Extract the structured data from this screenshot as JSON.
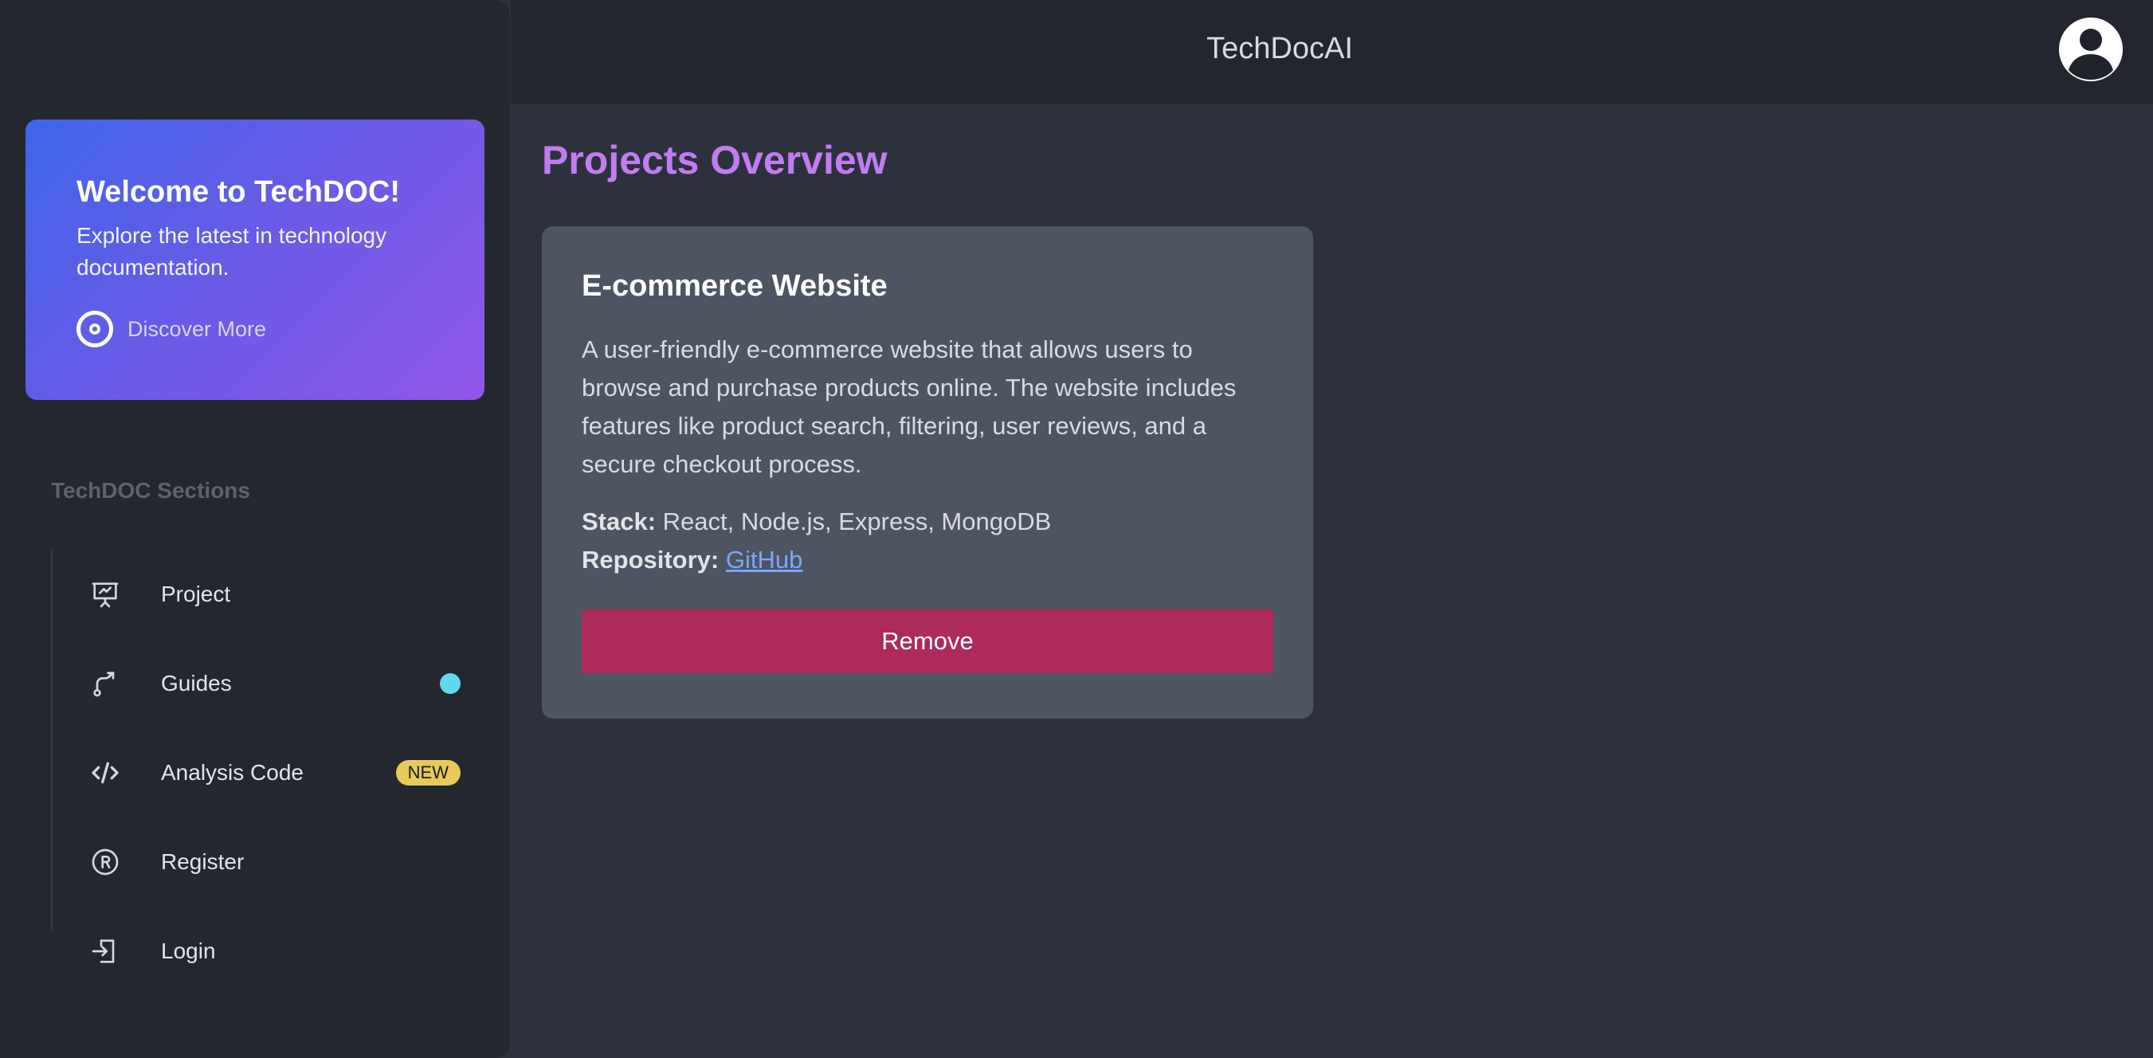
{
  "header": {
    "title": "TechDocAI",
    "avatar_icon": "user-avatar-icon"
  },
  "welcome": {
    "title": "Welcome to TechDOC!",
    "subtitle": "Explore the latest in technology documentation.",
    "discover_label": "Discover More",
    "gradient_start": "#3f66e8",
    "gradient_end": "#9256e6"
  },
  "sidebar": {
    "sections_title": "TechDOC Sections",
    "items": [
      {
        "label": "Project",
        "icon": "presentation-chart-icon"
      },
      {
        "label": "Guides",
        "icon": "route-icon",
        "indicator": "dot",
        "indicator_color": "#5fd9ec"
      },
      {
        "label": "Analysis Code",
        "icon": "code-icon",
        "badge": "NEW",
        "badge_color": "#e9c95a"
      },
      {
        "label": "Register",
        "icon": "registered-icon"
      },
      {
        "label": "Login",
        "icon": "login-icon"
      }
    ]
  },
  "main": {
    "title": "Projects Overview",
    "title_color": "#c27cf2",
    "project": {
      "title": "E-commerce Website",
      "description": "A user-friendly e-commerce website that allows users to browse and purchase products online. The website includes features like product search, filtering, user reviews, and a secure checkout process.",
      "stack_label": "Stack:",
      "stack_value": "React, Node.js, Express, MongoDB",
      "repo_label": "Repository:",
      "repo_link": "GitHub",
      "remove_label": "Remove",
      "remove_color": "#ae2a5a"
    }
  }
}
